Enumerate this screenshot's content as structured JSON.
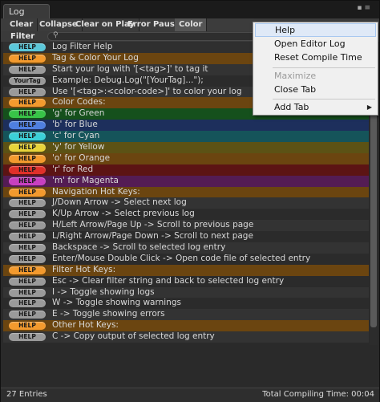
{
  "window": {
    "tab_title": "Log"
  },
  "toolbar": {
    "buttons": [
      "Clear",
      "Collapse",
      "Clear on Play",
      "Error Pause",
      "Color"
    ]
  },
  "filter": {
    "label": "Filter"
  },
  "rows": [
    {
      "tag": "HELP",
      "tag_color": "#5bc7d9",
      "row_bg": "#2f2f2f",
      "text": "Log Filter Help"
    },
    {
      "tag": "HELP",
      "tag_color": "#f39a2e",
      "row_bg": "#6b4510",
      "text": "Tag & Color Your Log"
    },
    {
      "tag": "HELP",
      "tag_color": "#9a9a9a",
      "row_bg": "#333333",
      "text": "Start your log with '[<tag>]' to tag it"
    },
    {
      "tag": "YourTag",
      "tag_color": "#9a9a9a",
      "row_bg": "#2b2b2b",
      "text": "Example: Debug.Log(\"[YourTag]...\");"
    },
    {
      "tag": "HELP",
      "tag_color": "#9a9a9a",
      "row_bg": "#333333",
      "text": "Use '[<tag>:<color-code>]' to color your log"
    },
    {
      "tag": "HELP",
      "tag_color": "#f39a2e",
      "row_bg": "#6b4510",
      "text": "Color Codes:"
    },
    {
      "tag": "HELP",
      "tag_color": "#38c448",
      "row_bg": "#15501c",
      "text": "'g' for Green"
    },
    {
      "tag": "HELP",
      "tag_color": "#4f7fe0",
      "row_bg": "#1d2f5c",
      "text": "'b' for Blue"
    },
    {
      "tag": "HELP",
      "tag_color": "#3cd0d8",
      "row_bg": "#15545a",
      "text": "'c' for Cyan"
    },
    {
      "tag": "HELP",
      "tag_color": "#e8d43a",
      "row_bg": "#5c5215",
      "text": "'y' for Yellow"
    },
    {
      "tag": "HELP",
      "tag_color": "#f39a2e",
      "row_bg": "#6b4510",
      "text": "'o' for Orange"
    },
    {
      "tag": "HELP",
      "tag_color": "#e0302a",
      "row_bg": "#5c1414",
      "text": "'r' for Red"
    },
    {
      "tag": "HELP",
      "tag_color": "#c840c0",
      "row_bg": "#541c54",
      "text": "'m' for Magenta"
    },
    {
      "tag": "HELP",
      "tag_color": "#f39a2e",
      "row_bg": "#6b4510",
      "text": "Navigation Hot Keys:"
    },
    {
      "tag": "HELP",
      "tag_color": "#9a9a9a",
      "row_bg": "#333333",
      "text": "J/Down Arrow -> Select next log"
    },
    {
      "tag": "HELP",
      "tag_color": "#9a9a9a",
      "row_bg": "#2b2b2b",
      "text": "K/Up Arrow -> Select previous log"
    },
    {
      "tag": "HELP",
      "tag_color": "#9a9a9a",
      "row_bg": "#333333",
      "text": "H/Left Arrow/Page Up -> Scroll to previous page"
    },
    {
      "tag": "HELP",
      "tag_color": "#9a9a9a",
      "row_bg": "#2b2b2b",
      "text": "L/Right Arrow/Page Down -> Scroll to next page"
    },
    {
      "tag": "HELP",
      "tag_color": "#9a9a9a",
      "row_bg": "#333333",
      "text": "Backspace -> Scroll to selected log entry"
    },
    {
      "tag": "HELP",
      "tag_color": "#9a9a9a",
      "row_bg": "#2b2b2b",
      "text": "Enter/Mouse Double Click -> Open code file of selected entry"
    },
    {
      "tag": "HELP",
      "tag_color": "#f39a2e",
      "row_bg": "#6b4510",
      "text": "Filter Hot Keys:"
    },
    {
      "tag": "HELP",
      "tag_color": "#9a9a9a",
      "row_bg": "#2b2b2b",
      "text": "Esc -> Clear filter string and back to selected log entry"
    },
    {
      "tag": "HELP",
      "tag_color": "#9a9a9a",
      "row_bg": "#333333",
      "text": "I -> Toggle showing logs"
    },
    {
      "tag": "HELP",
      "tag_color": "#9a9a9a",
      "row_bg": "#2b2b2b",
      "text": "W -> Toggle showing warnings"
    },
    {
      "tag": "HELP",
      "tag_color": "#9a9a9a",
      "row_bg": "#333333",
      "text": "E -> Toggle showing errors"
    },
    {
      "tag": "HELP",
      "tag_color": "#f39a2e",
      "row_bg": "#6b4510",
      "text": "Other Hot Keys:"
    },
    {
      "tag": "HELP",
      "tag_color": "#9a9a9a",
      "row_bg": "#333333",
      "text": "C -> Copy output of selected log entry"
    }
  ],
  "status": {
    "entries": "27 Entries",
    "compile_time": "Total Compiling Time: 00:04"
  },
  "menu": {
    "items": [
      {
        "label": "Help",
        "highlighted": true
      },
      {
        "label": "Open Editor Log"
      },
      {
        "label": "Reset Compile Time"
      },
      {
        "label": "Maximize",
        "disabled": true
      },
      {
        "label": "Close Tab"
      },
      {
        "label": "Add Tab",
        "submenu": true
      }
    ]
  }
}
